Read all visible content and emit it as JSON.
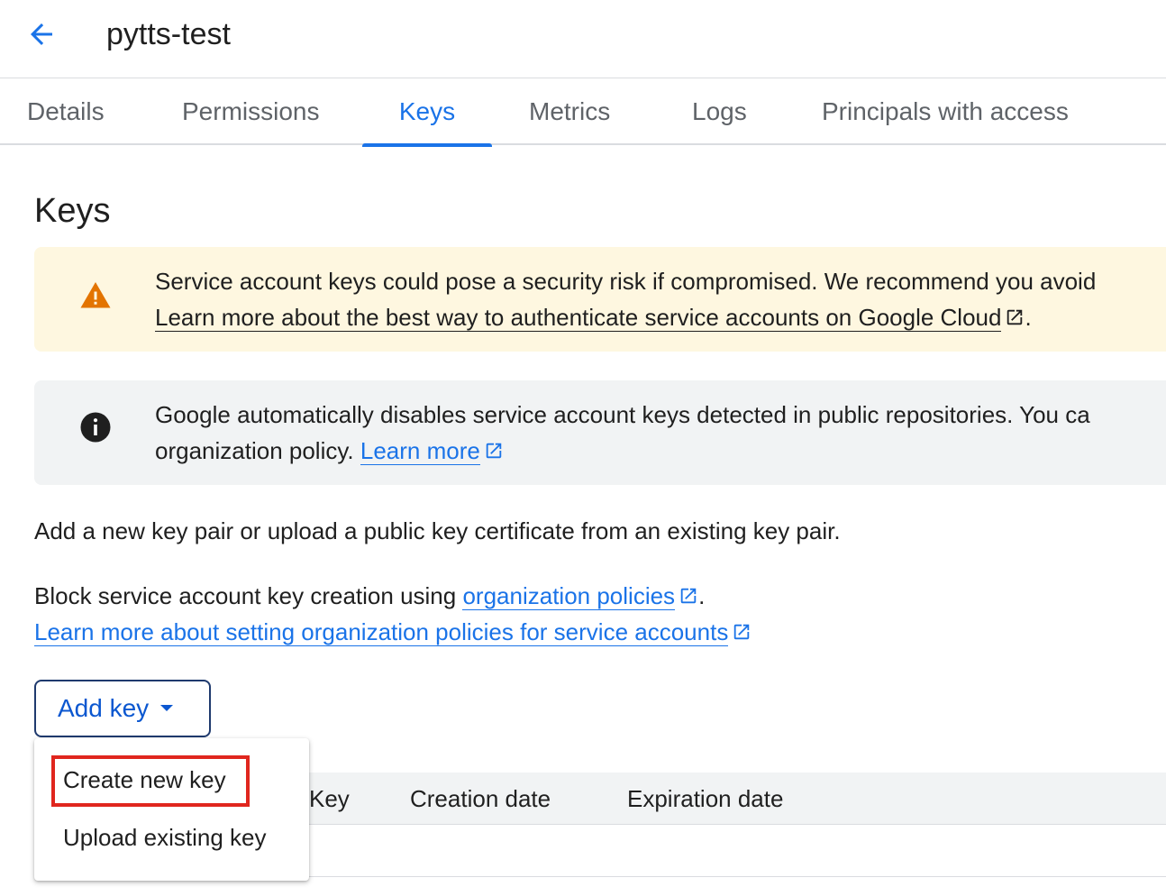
{
  "header": {
    "title": "pytts-test"
  },
  "tabs": [
    {
      "label": "Details"
    },
    {
      "label": "Permissions"
    },
    {
      "label": "Keys"
    },
    {
      "label": "Metrics"
    },
    {
      "label": "Logs"
    },
    {
      "label": "Principals with access"
    }
  ],
  "active_tab": "Keys",
  "section": {
    "title": "Keys"
  },
  "warning_banner": {
    "text": "Service account keys could pose a security risk if compromised. We recommend you avoid",
    "link": "Learn more about the best way to authenticate service accounts on Google Cloud",
    "trailing": "."
  },
  "info_banner": {
    "text_line1": "Google automatically disables service account keys detected in public repositories. You ca",
    "text_line2": "organization policy.",
    "link": "Learn more"
  },
  "description": "Add a new key pair or upload a public key certificate from an existing key pair.",
  "policy": {
    "prefix": "Block service account key creation using",
    "link1": "organization policies",
    "suffix": ".",
    "link2": "Learn more about setting organization policies for service accounts"
  },
  "add_key_button": {
    "label": "Add key"
  },
  "dropdown_menu": {
    "items": [
      {
        "label": "Create new key"
      },
      {
        "label": "Upload existing key"
      }
    ]
  },
  "table": {
    "columns": [
      "Key",
      "Creation date",
      "Expiration date"
    ]
  },
  "colors": {
    "accent": "#1a73e8",
    "warning_bg": "#fef7e0",
    "warning_icon": "#e37400",
    "info_bg": "#f1f3f4",
    "highlight": "#e0261e"
  }
}
